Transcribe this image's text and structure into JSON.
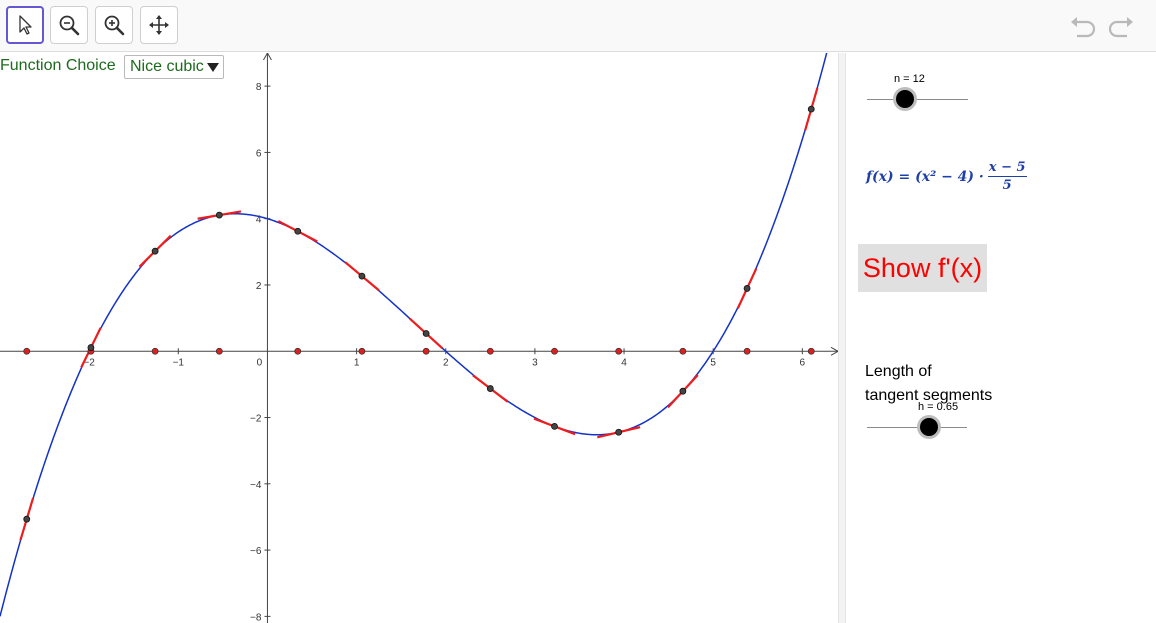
{
  "toolbar": {
    "tools": [
      {
        "name": "move-tool",
        "icon": "cursor-arrow-icon",
        "active": true
      },
      {
        "name": "zoom-out-tool",
        "icon": "zoom-out-icon",
        "active": false
      },
      {
        "name": "zoom-in-tool",
        "icon": "zoom-in-icon",
        "active": false
      },
      {
        "name": "pan-tool",
        "icon": "four-way-arrows-icon",
        "active": false
      }
    ],
    "undo_icon": "undo-icon",
    "redo_icon": "redo-icon",
    "accent_color": "#6557d2"
  },
  "function_choice": {
    "label": "Function Choice",
    "selected": "Nice cubic"
  },
  "sidebar": {
    "n_slider": {
      "label": "n = 12",
      "value": 12,
      "min": 1,
      "max": 30
    },
    "formula": {
      "lhs": "f(x) = (x² − 4) ·",
      "numerator": "x − 5",
      "denominator": "5"
    },
    "show_button": "Show f'(x)",
    "length_label_line1": "Length of",
    "length_label_line2": "tangent segments",
    "h_slider": {
      "label": "h = 0.65",
      "value": 0.65,
      "min": 0,
      "max": 1
    }
  },
  "chart_data": {
    "type": "line",
    "function": "(x^2 - 4) * (x - 5) / 5",
    "xlim": [
      -3,
      6.4
    ],
    "ylim": [
      -8.2,
      9
    ],
    "x_ticks": [
      -2,
      -1,
      0,
      1,
      2,
      3,
      4,
      5,
      6
    ],
    "x_tick_labels": [
      "−2",
      "−1",
      "0",
      "1",
      "2",
      "3",
      "4",
      "5",
      "6"
    ],
    "y_ticks": [
      -8,
      -6,
      -4,
      -2,
      2,
      4,
      6,
      8
    ],
    "y_tick_labels": [
      "−8",
      "−6",
      "−4",
      "−2",
      "2",
      "4",
      "6",
      "8"
    ],
    "sample_x": [
      -2.7,
      -1.98,
      -1.26,
      -0.54,
      0.34,
      1.06,
      1.78,
      2.5,
      3.22,
      3.94,
      4.66,
      5.38,
      6.1
    ],
    "curve_color": "#1432c8",
    "tangent_color": "#ee1c1c",
    "axis_point_color": "#e01e1e",
    "curve_point_color": "#444444",
    "grid": false
  }
}
